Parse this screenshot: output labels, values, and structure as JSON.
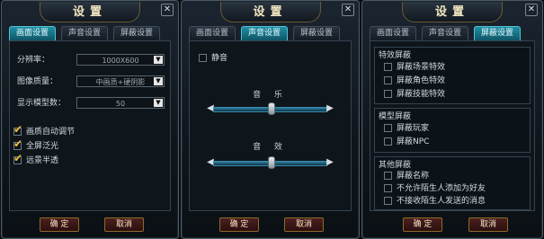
{
  "panel1": {
    "title": "设置",
    "tabs": [
      "画面设置",
      "声音设置",
      "屏蔽设置"
    ],
    "rows": [
      {
        "label": "分辨率：",
        "value": "1000X600"
      },
      {
        "label": "图像质量：",
        "value": "中画质+硬阴影"
      },
      {
        "label": "显示模型数：",
        "value": "50"
      }
    ],
    "checks": [
      {
        "label": "画质自动调节",
        "checked": true
      },
      {
        "label": "全屏泛光",
        "checked": true
      },
      {
        "label": "远景半透",
        "checked": true
      }
    ],
    "ok": "确 定",
    "cancel": "取消"
  },
  "panel2": {
    "title": "设置",
    "tabs": [
      "画面设置",
      "声音设置",
      "屏蔽设置"
    ],
    "mute": "静音",
    "music": "音 乐",
    "sound": "音 效",
    "music_level": 0.5,
    "sound_level": 0.5,
    "ok": "确 定",
    "cancel": "取消"
  },
  "panel3": {
    "title": "设置",
    "tabs": [
      "画面设置",
      "声音设置",
      "屏蔽设置"
    ],
    "sections": [
      {
        "title": "特效屏蔽",
        "items": [
          "屏蔽场景特效",
          "屏蔽角色特效",
          "屏蔽技能特效"
        ]
      },
      {
        "title": "模型屏蔽",
        "items": [
          "屏蔽玩家",
          "屏蔽NPC"
        ]
      },
      {
        "title": "其他屏蔽",
        "items": [
          "屏蔽名称",
          "不允许陌生人添加为好友",
          "不接收陌生人发送的消息"
        ]
      }
    ],
    "ok": "确 定",
    "cancel": "取消"
  },
  "icons": {
    "close": "close-icon",
    "dropdown": "chevron-down-icon",
    "check": "check-icon",
    "left": "arrow-left-icon",
    "right": "arrow-right-icon"
  }
}
